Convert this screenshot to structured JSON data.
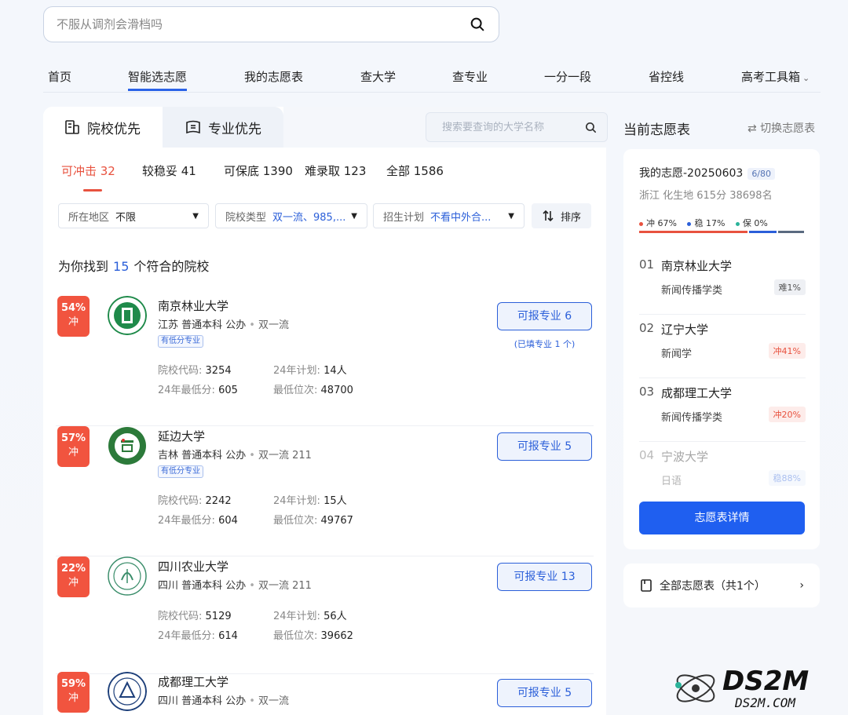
{
  "search": {
    "placeholder": "不服从调剂会滑档吗"
  },
  "nav": {
    "items": [
      "首页",
      "智能选志愿",
      "我的志愿表",
      "查大学",
      "查专业",
      "一分一段",
      "省控线",
      "高考工具箱"
    ],
    "active": "智能选志愿"
  },
  "tabs": {
    "school_first": "院校优先",
    "major_first": "专业优先"
  },
  "school_search": {
    "placeholder": "搜索要查询的大学名称"
  },
  "categories": [
    {
      "label": "可冲击 32"
    },
    {
      "label": "较稳妥 41"
    },
    {
      "label": "可保底 1390"
    },
    {
      "label": "难录取 123"
    },
    {
      "label": "全部 1586"
    }
  ],
  "filters": [
    {
      "label": "所在地区",
      "value": "不限"
    },
    {
      "label": "院校类型",
      "value": "双一流、985,..."
    },
    {
      "label": "招生计划",
      "value": "不看中外合..."
    }
  ],
  "sort_label": "排序",
  "found": {
    "prefix": "为你找到",
    "count": "15",
    "suffix": "个符合的院校"
  },
  "stat_labels": {
    "code": "院校代码:",
    "plan": "24年计划:",
    "min_score": "24年最低分:",
    "min_rank": "最低位次:"
  },
  "schools": [
    {
      "pct": "54%",
      "type": "冲",
      "name": "南京林业大学",
      "tags": "江苏 普通本科 公办",
      "extra": "双一流",
      "low_tag": "有低分专业",
      "code": "3254",
      "plan": "14人",
      "min_score": "605",
      "min_rank": "48700",
      "button": "可报专业 6",
      "note": "(已填专业 1 个)",
      "logo_color": "#1f8a4a"
    },
    {
      "pct": "57%",
      "type": "冲",
      "name": "延边大学",
      "tags": "吉林 普通本科 公办",
      "extra": "双一流 211",
      "low_tag": "有低分专业",
      "code": "2242",
      "plan": "15人",
      "min_score": "604",
      "min_rank": "49767",
      "button": "可报专业 5",
      "note": "",
      "logo_color": "#2c7a3a"
    },
    {
      "pct": "22%",
      "type": "冲",
      "name": "四川农业大学",
      "tags": "四川 普通本科 公办",
      "extra": "双一流 211",
      "low_tag": "",
      "code": "5129",
      "plan": "56人",
      "min_score": "614",
      "min_rank": "39662",
      "button": "可报专业 13",
      "note": "",
      "logo_color": "#3a8d6a"
    },
    {
      "pct": "59%",
      "type": "冲",
      "name": "成都理工大学",
      "tags": "四川 普通本科 公办",
      "extra": "双一流",
      "low_tag": "",
      "code": "",
      "plan": "",
      "min_score": "",
      "min_rank": "",
      "button": "可报专业 5",
      "note": "",
      "logo_color": "#1d3f7a"
    }
  ],
  "right": {
    "title": "当前志愿表",
    "switch": "⇄ 切换志愿表",
    "name": "我的志愿-20250603",
    "count": "6/80",
    "sub": "浙江 化生地 615分 38698名",
    "legend": [
      {
        "label": "冲 67%",
        "color": "#e8523f",
        "share": 0.67
      },
      {
        "label": "稳 17%",
        "color": "#2b5fd9",
        "share": 0.17
      },
      {
        "label": "保 0%",
        "color": "#2bb39a",
        "share": 0.16
      }
    ],
    "list": [
      {
        "no": "01",
        "name": "南京林业大学",
        "major": "新闻传播学类",
        "tag": "难1%",
        "kind": "hard"
      },
      {
        "no": "02",
        "name": "辽宁大学",
        "major": "新闻学",
        "tag": "冲41%",
        "kind": "chong"
      },
      {
        "no": "03",
        "name": "成都理工大学",
        "major": "新闻传播学类",
        "tag": "冲20%",
        "kind": "chong"
      },
      {
        "no": "04",
        "name": "宁波大学",
        "major": "日语",
        "tag": "稳88%",
        "kind": "bao"
      }
    ],
    "detail_button": "志愿表详情",
    "all_tables": "全部志愿表（共1个）"
  },
  "watermark": {
    "brand": "DS2M",
    "site": "DS2M.COM"
  }
}
